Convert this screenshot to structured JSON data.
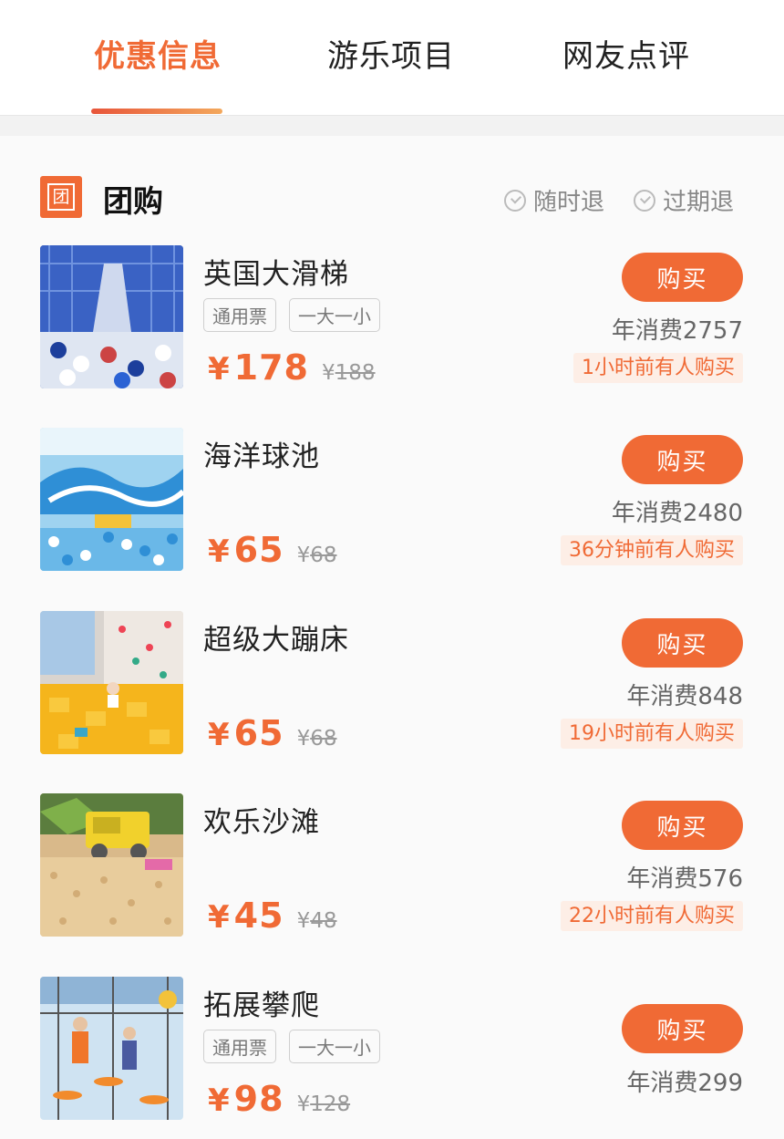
{
  "tabs": [
    {
      "label": "优惠信息",
      "active": true
    },
    {
      "label": "游乐项目",
      "active": false
    },
    {
      "label": "网友点评",
      "active": false
    }
  ],
  "section": {
    "badge": "团",
    "title": "团购",
    "policies": [
      "随时退",
      "过期退"
    ]
  },
  "colors": {
    "accent": "#f06a35",
    "recent_bg": "#fdeee6"
  },
  "items": [
    {
      "title": "英国大滑梯",
      "tags": [
        "通用票",
        "一大一小"
      ],
      "yen": "¥",
      "price": "178",
      "old_yen": "¥",
      "old_price": "188",
      "buy": "购买",
      "annual": "年消费2757",
      "recent": "1小时前有人购买",
      "image": "slide-photo"
    },
    {
      "title": "海洋球池",
      "tags": [],
      "yen": "¥",
      "price": "65",
      "old_yen": "¥",
      "old_price": "68",
      "buy": "购买",
      "annual": "年消费2480",
      "recent": "36分钟前有人购买",
      "image": "ball-pool-photo"
    },
    {
      "title": "超级大蹦床",
      "tags": [],
      "yen": "¥",
      "price": "65",
      "old_yen": "¥",
      "old_price": "68",
      "buy": "购买",
      "annual": "年消费848",
      "recent": "19小时前有人购买",
      "image": "trampoline-photo"
    },
    {
      "title": "欢乐沙滩",
      "tags": [],
      "yen": "¥",
      "price": "45",
      "old_yen": "¥",
      "old_price": "48",
      "buy": "购买",
      "annual": "年消费576",
      "recent": "22小时前有人购买",
      "image": "sand-beach-photo"
    },
    {
      "title": "拓展攀爬",
      "tags": [
        "通用票",
        "一大一小"
      ],
      "yen": "¥",
      "price": "98",
      "old_yen": "¥",
      "old_price": "128",
      "buy": "购买",
      "annual": "年消费299",
      "recent": "",
      "image": "climbing-photo"
    }
  ]
}
